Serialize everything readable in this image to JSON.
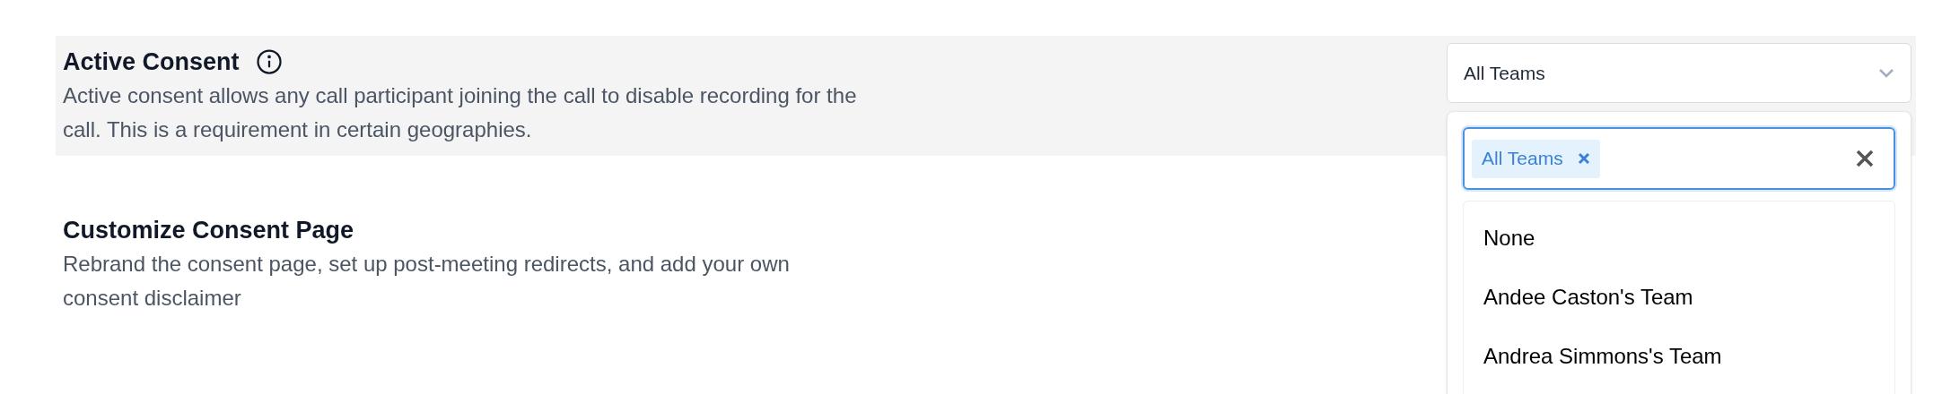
{
  "sections": [
    {
      "title": "Active Consent",
      "info_icon": true,
      "highlighted": true,
      "description": "Active consent allows any call participant joining the call to disable recording for the call. This is a requirement in certain geographies."
    },
    {
      "title": "Customize Consent Page",
      "info_icon": false,
      "highlighted": false,
      "description": "Rebrand the consent page, set up post-meeting redirects, and add your own consent disclaimer"
    }
  ],
  "team_select": {
    "value": "All Teams",
    "expanded": true,
    "chips": [
      "All Teams"
    ],
    "options": [
      {
        "label": "None",
        "selected": false
      },
      {
        "label": "Andee Caston's Team",
        "selected": false
      },
      {
        "label": "Andrea Simmons's Team",
        "selected": false
      }
    ]
  }
}
